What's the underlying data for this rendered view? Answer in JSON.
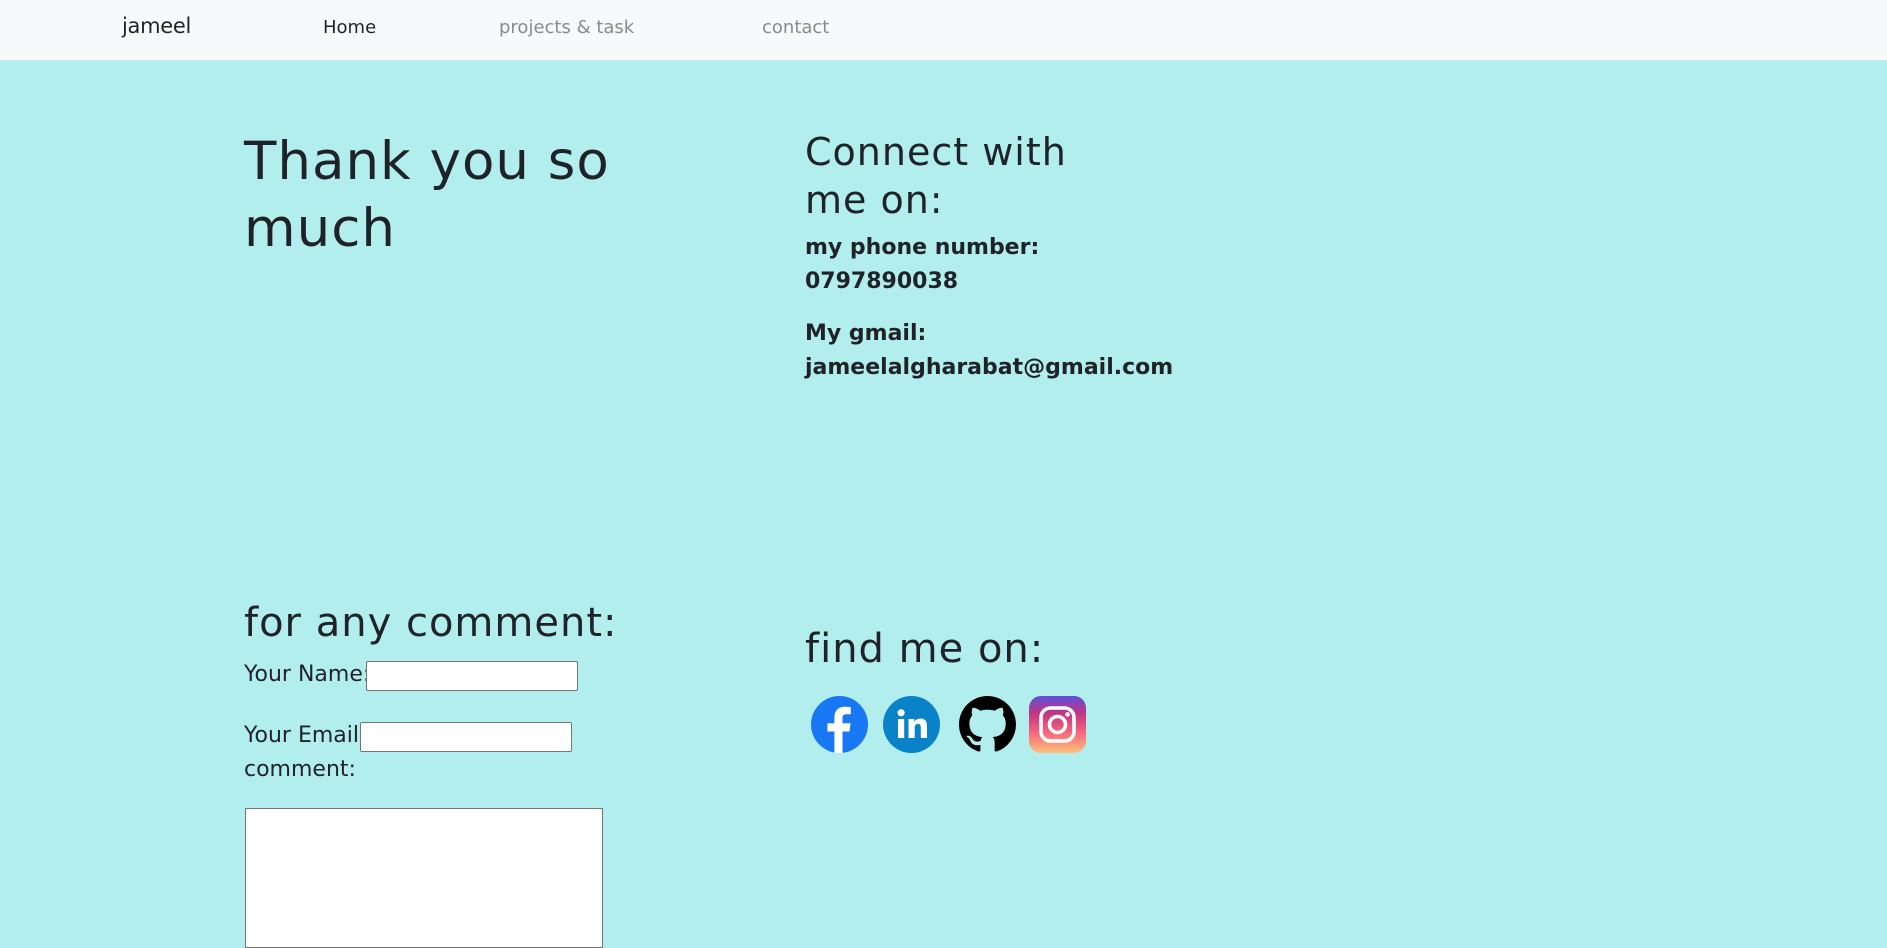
{
  "navbar": {
    "brand": "jameel",
    "links": [
      {
        "label": "Home"
      },
      {
        "label": "projects & task"
      },
      {
        "label": "contact"
      }
    ]
  },
  "thanks": {
    "heading": "Thank you so much"
  },
  "connect": {
    "heading": "Connect with me on:",
    "phone_label": "my phone number:",
    "phone_value": "0797890038",
    "gmail_label": "My gmail:",
    "gmail_value": "jameelalgharabat@gmail.com"
  },
  "comment_form": {
    "heading": "for any comment:",
    "name_label": "Your Name:",
    "name_value": "",
    "email_label": "Your Email:",
    "email_value": "",
    "comment_label": "comment:",
    "comment_value": ""
  },
  "social": {
    "heading": "find me on:",
    "icons": [
      {
        "name": "facebook-icon",
        "color": "#1877f2"
      },
      {
        "name": "linkedin-icon",
        "color": "#0a82c8"
      },
      {
        "name": "github-icon",
        "color": "#000000"
      },
      {
        "name": "instagram-icon",
        "color": "#c13584"
      }
    ]
  },
  "colors": {
    "page_background": "#b2eeee",
    "navbar_background": "#f8f9fb",
    "text": "#1f2328",
    "nav_muted": "#8a8a8a"
  }
}
